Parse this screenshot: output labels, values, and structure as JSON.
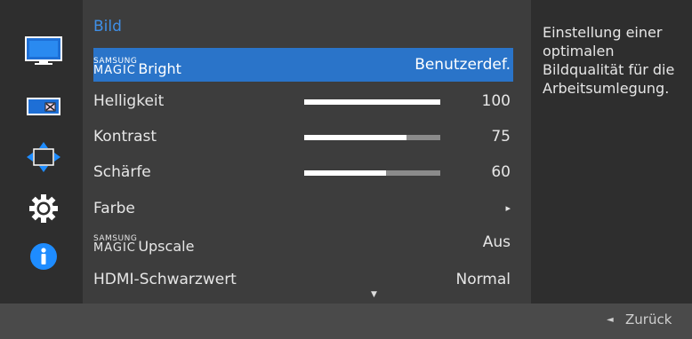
{
  "sidebar": {
    "icons": [
      "picture-icon",
      "onscreen-display-icon",
      "position-icon",
      "settings-gear-icon",
      "information-icon"
    ]
  },
  "menu": {
    "title": "Bild",
    "rows": [
      {
        "brand_top": "SAMSUNG",
        "brand_main": "MAGIC",
        "label": "Bright",
        "value": "Benutzerdef.",
        "selected": true
      },
      {
        "label": "Helligkeit",
        "value": "100",
        "level": 100
      },
      {
        "label": "Kontrast",
        "value": "75",
        "level": 75
      },
      {
        "label": "Schärfe",
        "value": "60",
        "level": 60
      },
      {
        "label": "Farbe",
        "value": "▸"
      },
      {
        "brand_top": "SAMSUNG",
        "brand_main": "MAGIC",
        "label": "Upscale",
        "value": "Aus"
      },
      {
        "label": "HDMI-Schwarzwert",
        "value": "Normal"
      }
    ],
    "more_indicator": "▼"
  },
  "help": {
    "text": "Einstellung einer optimalen Bildqualität für die Arbeitsumlegung."
  },
  "footer": {
    "back_arrow": "◄",
    "back_label": "Zurück"
  },
  "colors": {
    "accent": "#2a74c9",
    "title": "#3f8fe6",
    "panel": "#3d3d3d",
    "background": "#2e2e2e",
    "footer": "#4a4a4a"
  }
}
